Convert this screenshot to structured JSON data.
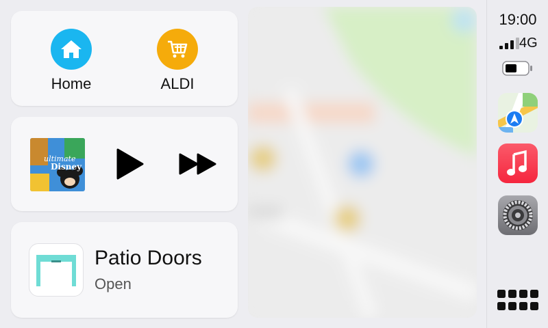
{
  "time": "19:00",
  "network": "4G",
  "destinations": [
    {
      "label": "Home",
      "icon": "house-icon",
      "color": "#1ab6f0"
    },
    {
      "label": "ALDI",
      "icon": "cart-icon",
      "color": "#f5ab0b"
    }
  ],
  "now_playing": {
    "album_art_text": "ultimate Disney",
    "play_icon": "play-icon",
    "next_icon": "fast-forward-icon"
  },
  "accessory": {
    "title": "Patio Doors",
    "status": "Open",
    "icon": "garage-door-icon"
  },
  "dock_apps": [
    {
      "name": "Maps",
      "icon": "maps-icon"
    },
    {
      "name": "Music",
      "icon": "music-icon"
    },
    {
      "name": "Settings",
      "icon": "settings-gear-icon"
    }
  ],
  "colors": {
    "accent_blue": "#1ab6f0",
    "accent_yellow": "#f5ab0b",
    "music_red": "#fa3a4c",
    "door_teal": "#6fdcd5"
  }
}
